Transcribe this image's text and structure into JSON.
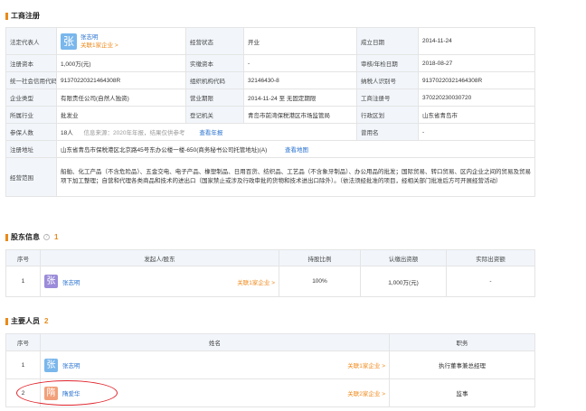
{
  "sections": {
    "business": "工商注册",
    "shareholders": "股东信息",
    "shareholders_count": "1",
    "members": "主要人员",
    "members_count": "2"
  },
  "registration": {
    "legal_rep_label": "法定代表人",
    "legal_rep_avatar": "张",
    "legal_rep_name": "张志明",
    "legal_rep_link": "关联1家企业 >",
    "status_label": "经营状态",
    "status_value": "开业",
    "founded_label": "成立日期",
    "founded_value": "2014-11-24",
    "capital_label": "注册资本",
    "capital_value": "1,000万(元)",
    "paid_label": "实缴资本",
    "paid_value": "-",
    "approval_label": "审核/年检日期",
    "approval_value": "2018-08-27",
    "credit_label": "统一社会信用代码",
    "credit_value": "91370220321464308R",
    "org_label": "组织机构代码",
    "org_value": "32146430-8",
    "tax_label": "纳税人识别号",
    "tax_value": "91370220321464308R",
    "type_label": "企业类型",
    "type_value": "有限责任公司(自然人独资)",
    "term_label": "营业期限",
    "term_value": "2014-11-24 至 无固定期限",
    "regno_label": "工商注册号",
    "regno_value": "370220230030720",
    "industry_label": "所属行业",
    "industry_value": "批发业",
    "authority_label": "登记机关",
    "authority_value": "青岛市前湾保税港区市场监管局",
    "region_label": "行政区划",
    "region_value": "山东省青岛市",
    "insured_label": "参保人数",
    "insured_value": "18人",
    "insured_note": "信息来源：2020年年报，结果仅供参考",
    "insured_link": "查看年报",
    "former_label": "曾用名",
    "former_value": "-",
    "address_label": "注册地址",
    "address_value": "山东省青岛市保税港区北京路45号东办公楼一楼-650(商务秘书公司托管地址)(A)",
    "address_link": "查看地图",
    "scope_label": "经营范围",
    "scope_value": "船舶、化工产品（不含危险品）、五金交电、电子产品、橡塑制品、日用百货、纺织品、工艺品（不含象牙制品）、办公用品的批发；国际贸易、转口贸易、区内企业之间的贸易及贸易项下加工整理；自营和代理各类商品和技术的进出口（国家禁止或涉及行政审批的货物和技术进出口除外）。（依法须经批准的项目，经相关部门批准后方可开展经营活动）"
  },
  "shareholders_table": {
    "headers": [
      "序号",
      "发起人/股东",
      "持股比例",
      "认缴出资额",
      "实际出资额"
    ],
    "rows": [
      {
        "no": "1",
        "avatar": "张",
        "name": "张志明",
        "link": "关联1家企业 >",
        "ratio": "100%",
        "subscribed": "1,000万(元)",
        "actual": "-"
      }
    ]
  },
  "members_table": {
    "headers": [
      "序号",
      "姓名",
      "职务"
    ],
    "rows": [
      {
        "no": "1",
        "avatar": "张",
        "name": "张志明",
        "link": "关联1家企业 >",
        "role": "执行董事兼总经理"
      },
      {
        "no": "2",
        "avatar": "隋",
        "name": "隋爱华",
        "link": "关联2家企业 >",
        "role": "监事"
      }
    ]
  },
  "colors": {
    "accent": "#e88a1a",
    "link": "#2a73d0",
    "highlight": "#e0222a"
  }
}
